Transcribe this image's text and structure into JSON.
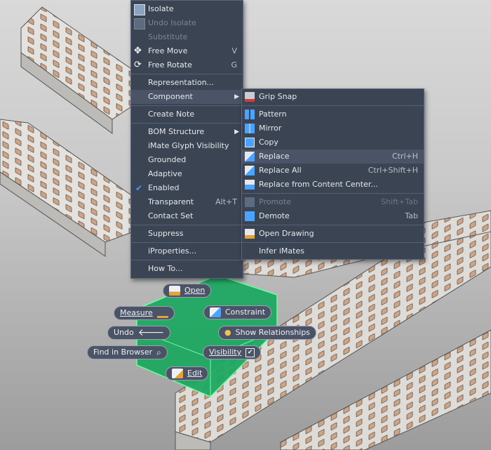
{
  "main_menu": [
    {
      "label": "Isolate",
      "icon": "isolate-icon",
      "disabled": false
    },
    {
      "label": "Undo Isolate",
      "icon": "undo-isolate-icon",
      "disabled": true
    },
    {
      "label": "Substitute",
      "icon": "",
      "disabled": true
    },
    {
      "label": "Free Move",
      "icon": "free-move-icon",
      "shortcut": "V",
      "disabled": false
    },
    {
      "label": "Free Rotate",
      "icon": "free-rotate-icon",
      "shortcut": "G",
      "disabled": false
    },
    {
      "label": "Representation...",
      "disabled": false
    },
    {
      "label": "Component",
      "submenu": true,
      "highlighted": true,
      "disabled": false
    },
    {
      "label": "Create Note",
      "disabled": false
    },
    {
      "label": "BOM Structure",
      "submenu": true,
      "disabled": false
    },
    {
      "label": "iMate Glyph Visibility",
      "disabled": false
    },
    {
      "label": "Grounded",
      "disabled": false
    },
    {
      "label": "Adaptive",
      "disabled": false
    },
    {
      "label": "Enabled",
      "checked": true,
      "disabled": false
    },
    {
      "label": "Transparent",
      "shortcut": "Alt+T",
      "disabled": false
    },
    {
      "label": "Contact Set",
      "disabled": false
    },
    {
      "label": "Suppress",
      "disabled": false
    },
    {
      "label": "iProperties...",
      "disabled": false
    },
    {
      "label": "How To...",
      "disabled": false
    }
  ],
  "component_submenu": [
    {
      "label": "Grip Snap",
      "icon": "grip-snap-icon",
      "disabled": false
    },
    {
      "label": "Pattern",
      "icon": "pattern-icon",
      "disabled": false
    },
    {
      "label": "Mirror",
      "icon": "mirror-icon",
      "disabled": false
    },
    {
      "label": "Copy",
      "icon": "copy-icon",
      "disabled": false
    },
    {
      "label": "Replace",
      "icon": "replace-icon",
      "shortcut": "Ctrl+H",
      "highlighted": true,
      "disabled": false
    },
    {
      "label": "Replace All",
      "icon": "replace-all-icon",
      "shortcut": "Ctrl+Shift+H",
      "disabled": false
    },
    {
      "label": "Replace from Content Center...",
      "icon": "content-center-icon",
      "disabled": false
    },
    {
      "label": "Promote",
      "icon": "promote-icon",
      "shortcut": "Shift+Tab",
      "disabled": true
    },
    {
      "label": "Demote",
      "icon": "demote-icon",
      "shortcut": "Tab",
      "disabled": false
    },
    {
      "label": "Open Drawing",
      "icon": "open-drawing-icon",
      "disabled": false
    },
    {
      "label": "Infer iMates",
      "icon": "",
      "disabled": false
    }
  ],
  "marking_menu": {
    "open": "Open",
    "measure": "Measure",
    "constraint": "Constraint",
    "undo": "Undo",
    "show_relationships": "Show Relationships",
    "find_in_browser": "Find in Browser",
    "visibility": "Visibility",
    "edit": "Edit"
  },
  "colors": {
    "menu_bg": "#3b4453",
    "menu_highlight": "#4a5466",
    "selection_green": "#1fa862",
    "check_blue": "#39a0ff"
  }
}
